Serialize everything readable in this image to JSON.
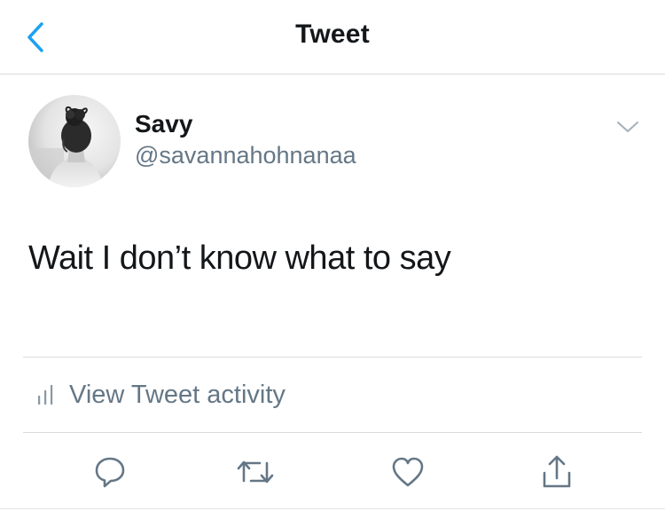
{
  "nav": {
    "title": "Tweet",
    "back_icon": "chevron-left-icon",
    "accent_color": "#1da1f2"
  },
  "tweet": {
    "author": {
      "display_name": "Savy",
      "handle": "@savannahohnanaa"
    },
    "text": "Wait I don’t know what to say",
    "more_icon": "chevron-down-icon"
  },
  "activity": {
    "label": "View Tweet activity",
    "icon": "bar-chart-icon"
  },
  "actions": [
    {
      "name": "reply",
      "icon": "reply-icon"
    },
    {
      "name": "retweet",
      "icon": "retweet-icon"
    },
    {
      "name": "like",
      "icon": "heart-icon"
    },
    {
      "name": "share",
      "icon": "share-icon"
    }
  ],
  "colors": {
    "text_primary": "#14171a",
    "text_secondary": "#657786",
    "divider": "#d8dbde"
  }
}
